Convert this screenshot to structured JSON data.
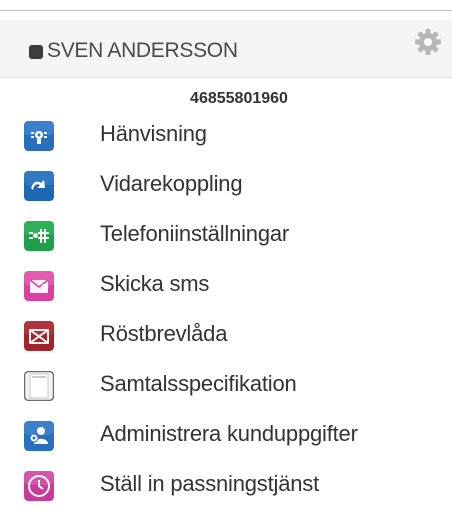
{
  "header": {
    "user_name": "SVEN ANDERSSON",
    "status_icon": "status-square-icon",
    "settings_icon": "gear-icon"
  },
  "phone_number": "46855801960",
  "menu": [
    {
      "label": "Hänvisning",
      "icon": "redirect-icon",
      "color": "#2a6fbd"
    },
    {
      "label": "Vidarekoppling",
      "icon": "call-forward-icon",
      "color": "#1e68b4"
    },
    {
      "label": "Telefoniinställningar",
      "icon": "phone-settings-icon",
      "color": "#1fa04a"
    },
    {
      "label": "Skicka sms",
      "icon": "sms-envelope-icon",
      "color": "#d9409f"
    },
    {
      "label": "Röstbrevlåda",
      "icon": "voicemail-envelope-icon",
      "color": "#a1242c"
    },
    {
      "label": "Samtalsspecifikation",
      "icon": "document-icon",
      "color": "#f0f0f0"
    },
    {
      "label": "Administrera kunduppgifter",
      "icon": "admin-users-icon",
      "color": "#2a6fbd"
    },
    {
      "label": "Ställ in passningstjänst",
      "icon": "clock-icon",
      "color": "#c93a9e"
    }
  ]
}
